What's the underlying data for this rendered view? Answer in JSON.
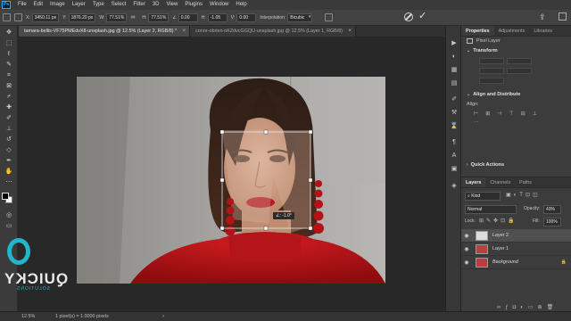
{
  "menu": [
    "File",
    "Edit",
    "Image",
    "Layer",
    "Type",
    "Select",
    "Filter",
    "3D",
    "View",
    "Plugins",
    "Window",
    "Help"
  ],
  "options": {
    "x_label": "X:",
    "x_value": "3450.11 px",
    "y_label": "Y:",
    "y_value": "1876.20 px",
    "w_label": "W:",
    "w_value": "77.51%",
    "h_label": "H:",
    "h_value": "77.51%",
    "angle_value": "0.00",
    "hskew_label": "H:",
    "hskew_value": "-1.05",
    "vskew_label": "V:",
    "vskew_value": "0.00",
    "interp_label": "Interpolation:",
    "interp_value": "Bicubic"
  },
  "tabs": [
    {
      "label": "tamara-bellis-VF75PMEdvX8-unsplash.jpg @ 12.5% (Layer 2, RGB/8) *",
      "active": true
    },
    {
      "label": "conor-obrien-nKZdvcGGQU-unsplash.jpg @ 12.5% (Layer 1, RGB/8)",
      "active": false
    }
  ],
  "canvas": {
    "transform_tooltip": "∠: -1.0°"
  },
  "watermark": {
    "brand": "QUICKY",
    "sub": "SOLUTIONS"
  },
  "status": {
    "zoom": "12.5%",
    "info": "1 pixel(s) = 1.0000 pixels"
  },
  "properties": {
    "tabs": [
      "Properties",
      "Adjustments",
      "Libraries"
    ],
    "layer_kind": "Pixel Layer",
    "transform_title": "Transform",
    "align_title": "Align and Distribute",
    "align_label": "Align:",
    "quick_title": "Quick Actions"
  },
  "layers": {
    "tabs": [
      "Layers",
      "Channels",
      "Paths"
    ],
    "kind_placeholder": "Kind",
    "blend_mode": "Normal",
    "opacity_label": "Opacity:",
    "opacity_value": "43%",
    "lock_label": "Lock:",
    "fill_label": "Fill:",
    "fill_value": "100%",
    "items": [
      {
        "name": "Layer 2",
        "active": true,
        "italic": false
      },
      {
        "name": "Layer 1",
        "active": false,
        "italic": false
      },
      {
        "name": "Background",
        "active": false,
        "italic": true
      }
    ]
  },
  "colors": {
    "accent": "#31a8ff",
    "sweater": "#c2181c",
    "earring": "#b31218"
  }
}
